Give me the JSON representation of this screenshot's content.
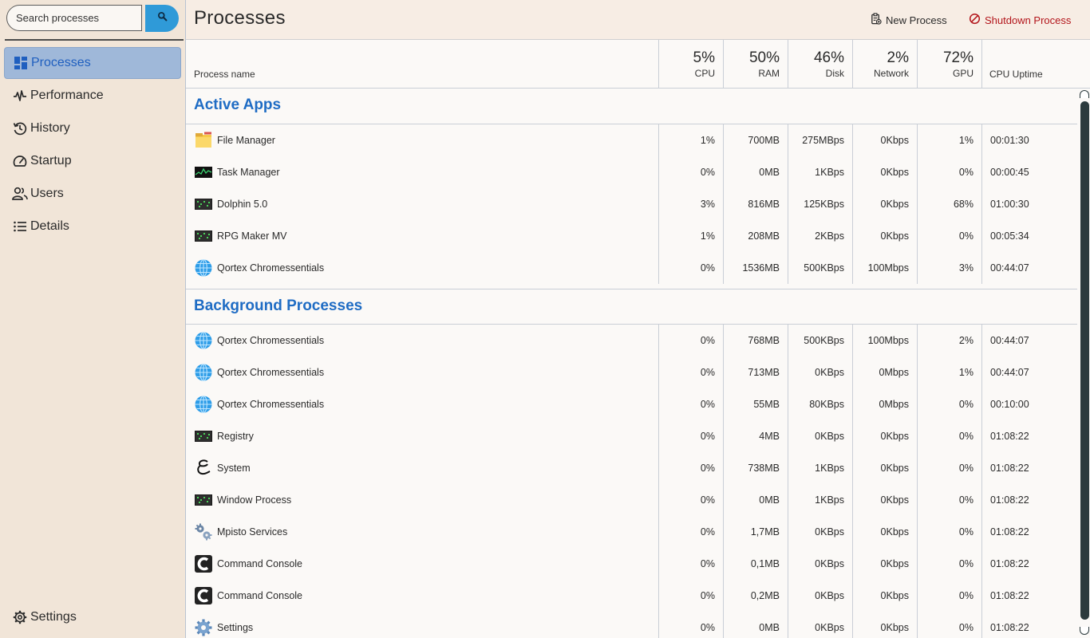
{
  "search": {
    "placeholder": "Search processes"
  },
  "nav": {
    "items": [
      {
        "label": "Processes",
        "icon": "dashboard-icon",
        "active": true
      },
      {
        "label": "Performance",
        "icon": "pulse-icon"
      },
      {
        "label": "History",
        "icon": "history-icon"
      },
      {
        "label": "Startup",
        "icon": "gauge-icon"
      },
      {
        "label": "Users",
        "icon": "users-icon"
      },
      {
        "label": "Details",
        "icon": "list-icon"
      }
    ],
    "settings": {
      "label": "Settings",
      "icon": "gear-icon"
    }
  },
  "header": {
    "title": "Processes",
    "new_process": "New Process",
    "shutdown_process": "Shutdown Process"
  },
  "columns": {
    "name": "Process name",
    "cpu": {
      "pct": "5%",
      "label": "CPU"
    },
    "ram": {
      "pct": "50%",
      "label": "RAM"
    },
    "disk": {
      "pct": "46%",
      "label": "Disk"
    },
    "network": {
      "pct": "2%",
      "label": "Network"
    },
    "gpu": {
      "pct": "72%",
      "label": "GPU"
    },
    "uptime": "CPU Uptime"
  },
  "sections": [
    {
      "title": "Active Apps",
      "rows": [
        {
          "name": "File Manager",
          "icon": "folder-icon",
          "cpu": "1%",
          "ram": "700MB",
          "disk": "275MBps",
          "net": "0Kbps",
          "gpu": "1%",
          "uptime": "00:01:30"
        },
        {
          "name": "Task Manager",
          "icon": "monitor-graph-icon",
          "cpu": "0%",
          "ram": "0MB",
          "disk": "1KBps",
          "net": "0Kbps",
          "gpu": "0%",
          "uptime": "00:00:45"
        },
        {
          "name": "Dolphin 5.0",
          "icon": "terminal-icon",
          "cpu": "3%",
          "ram": "816MB",
          "disk": "125KBps",
          "net": "0Kbps",
          "gpu": "68%",
          "uptime": "01:00:30"
        },
        {
          "name": "RPG Maker MV",
          "icon": "terminal-icon",
          "cpu": "1%",
          "ram": "208MB",
          "disk": "2KBps",
          "net": "0Kbps",
          "gpu": "0%",
          "uptime": "00:05:34"
        },
        {
          "name": "Qortex Chromessentials",
          "icon": "globe-icon",
          "cpu": "0%",
          "ram": "1536MB",
          "disk": "500KBps",
          "net": "100Mbps",
          "gpu": "3%",
          "uptime": "00:44:07"
        }
      ]
    },
    {
      "title": "Background Processes",
      "rows": [
        {
          "name": "Qortex Chromessentials",
          "icon": "globe-icon",
          "cpu": "0%",
          "ram": "768MB",
          "disk": "500KBps",
          "net": "100Mbps",
          "gpu": "2%",
          "uptime": "00:44:07"
        },
        {
          "name": "Qortex Chromessentials",
          "icon": "globe-icon",
          "cpu": "0%",
          "ram": "713MB",
          "disk": "0KBps",
          "net": "0Mbps",
          "gpu": "1%",
          "uptime": "00:44:07"
        },
        {
          "name": "Qortex Chromessentials",
          "icon": "globe-icon",
          "cpu": "0%",
          "ram": "55MB",
          "disk": "80KBps",
          "net": "0Mbps",
          "gpu": "0%",
          "uptime": "00:10:00"
        },
        {
          "name": "Registry",
          "icon": "terminal-icon",
          "cpu": "0%",
          "ram": "4MB",
          "disk": "0KBps",
          "net": "0Kbps",
          "gpu": "0%",
          "uptime": "01:08:22"
        },
        {
          "name": "System",
          "icon": "system-logo-icon",
          "cpu": "0%",
          "ram": "738MB",
          "disk": "1KBps",
          "net": "0Kbps",
          "gpu": "0%",
          "uptime": "01:08:22"
        },
        {
          "name": "Window Process",
          "icon": "terminal-icon",
          "cpu": "0%",
          "ram": "0MB",
          "disk": "1KBps",
          "net": "0Kbps",
          "gpu": "0%",
          "uptime": "01:08:22"
        },
        {
          "name": "Mpisto Services",
          "icon": "gears-icon",
          "cpu": "0%",
          "ram": "1,7MB",
          "disk": "0KBps",
          "net": "0Kbps",
          "gpu": "0%",
          "uptime": "01:08:22"
        },
        {
          "name": "Command Console",
          "icon": "console-c-icon",
          "cpu": "0%",
          "ram": "0,1MB",
          "disk": "0KBps",
          "net": "0Kbps",
          "gpu": "0%",
          "uptime": "01:08:22"
        },
        {
          "name": "Command Console",
          "icon": "console-c-icon",
          "cpu": "0%",
          "ram": "0,2MB",
          "disk": "0KBps",
          "net": "0Kbps",
          "gpu": "0%",
          "uptime": "01:08:22"
        },
        {
          "name": "Settings",
          "icon": "gear-color-icon",
          "cpu": "0%",
          "ram": "0MB",
          "disk": "0KBps",
          "net": "0Kbps",
          "gpu": "0%",
          "uptime": "01:08:22"
        }
      ]
    }
  ],
  "colors": {
    "sidebar_bg": "#f1e5d8",
    "accent_blue": "#2f9ad8",
    "section_blue": "#1f6cc4",
    "active_nav": "#9fb8d9",
    "danger": "#b3151b"
  }
}
